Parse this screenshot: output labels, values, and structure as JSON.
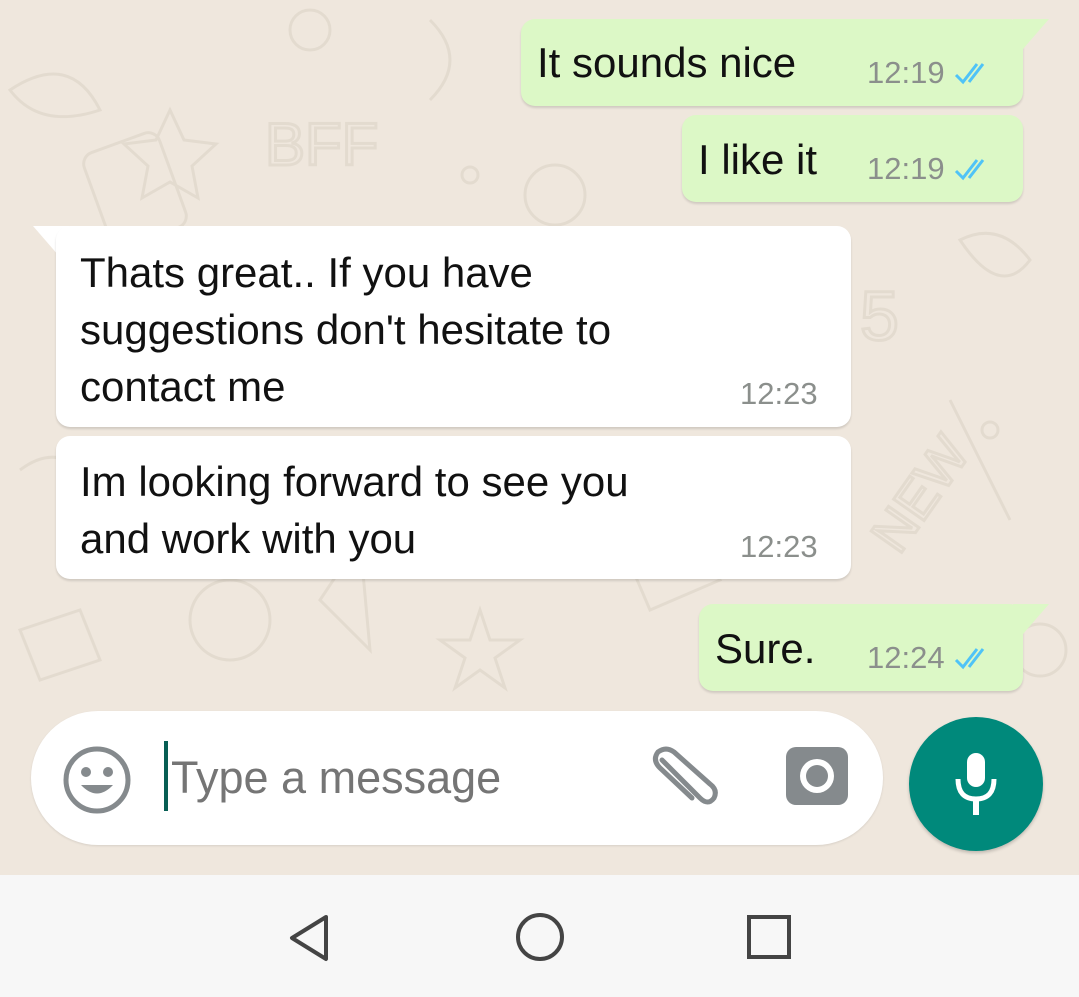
{
  "messages": [
    {
      "direction": "outgoing",
      "text": "It sounds nice",
      "time": "12:19",
      "status": "read"
    },
    {
      "direction": "outgoing",
      "text": "I like it",
      "time": "12:19",
      "status": "read"
    },
    {
      "direction": "incoming",
      "text": "Thats great.. If you have\nsuggestions don't hesitate to\ncontact me",
      "time": "12:23"
    },
    {
      "direction": "incoming",
      "text": "Im looking forward to see you\nand work with you",
      "time": "12:23"
    },
    {
      "direction": "outgoing",
      "text": "Sure.",
      "time": "12:24",
      "status": "read"
    }
  ],
  "composer": {
    "placeholder": "Type a message",
    "emoji_icon": "emoji-smile-icon",
    "attach_icon": "paperclip-icon",
    "camera_icon": "camera-icon",
    "mic_icon": "microphone-icon"
  },
  "navigation": {
    "back_icon": "triangle-back-icon",
    "home_icon": "circle-home-icon",
    "recents_icon": "square-recents-icon"
  },
  "colors": {
    "outgoing_bubble": "#dcf8c6",
    "incoming_bubble": "#ffffff",
    "read_ticks": "#4fc3f7",
    "accent": "#00897b",
    "wallpaper": "#efe7dd"
  }
}
